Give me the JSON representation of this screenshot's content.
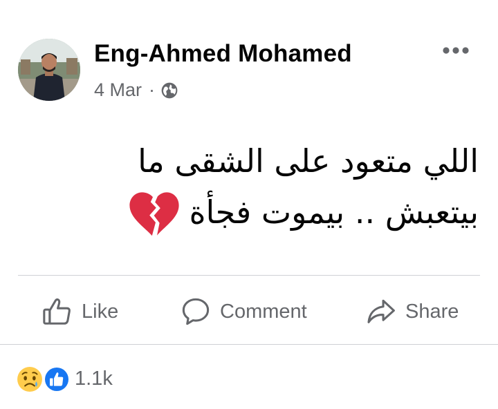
{
  "post": {
    "author_name": "Eng-Ahmed Mohamed",
    "date": "4 Mar",
    "separator": "·",
    "privacy_icon": "globe-icon",
    "more_icon": "more-options-icon",
    "text_line_1": "اللي متعود على الشقى ما",
    "text_line_2": "بيتعبش .. بيموت فجأة",
    "emoji": "broken-heart-emoji"
  },
  "actions": {
    "like_label": "Like",
    "comment_label": "Comment",
    "share_label": "Share"
  },
  "reactions": {
    "icons": [
      "sad-reaction-icon",
      "like-reaction-icon"
    ],
    "count": "1.1k"
  },
  "colors": {
    "text_primary": "#050505",
    "text_secondary": "#65676b",
    "divider": "#ced0d4",
    "like_blue": "#1877f2",
    "heart_red": "#dd2e44",
    "sad_yellow": "#ffcc4d"
  }
}
